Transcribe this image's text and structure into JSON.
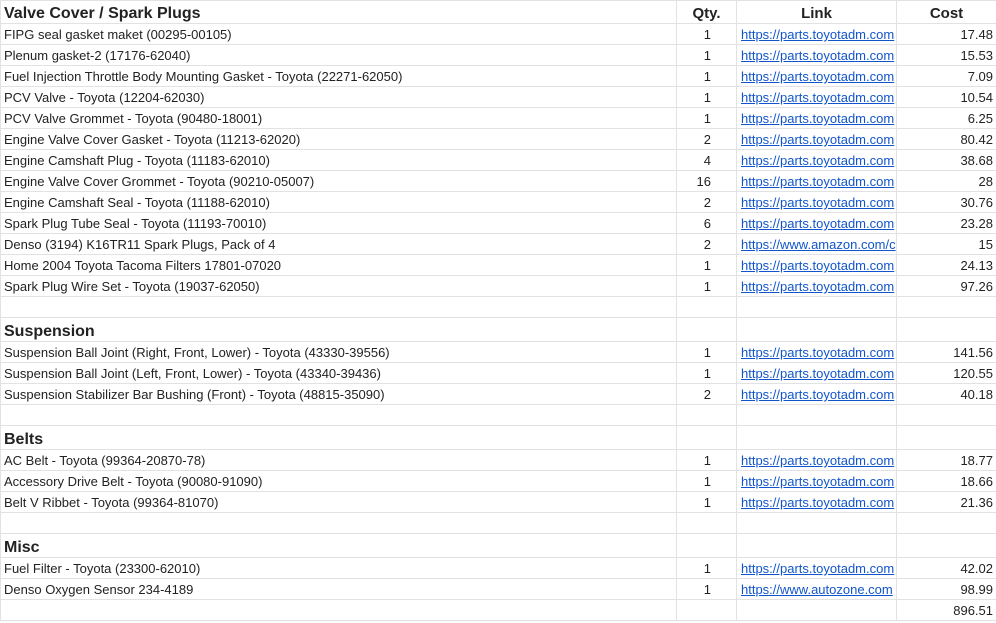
{
  "columns": {
    "item": "Valve Cover / Spark Plugs",
    "qty": "Qty.",
    "link": "Link",
    "cost": "Cost"
  },
  "rows": [
    {
      "type": "item",
      "name": "FIPG seal gasket maket (00295-00105)",
      "qty": "1",
      "link": "https://parts.toyotadm.com",
      "cost": "17.48"
    },
    {
      "type": "item",
      "name": "Plenum gasket-2 (17176-62040)",
      "qty": "1",
      "link": "https://parts.toyotadm.com",
      "cost": "15.53"
    },
    {
      "type": "item",
      "name": "Fuel Injection Throttle Body Mounting Gasket - Toyota (22271-62050)",
      "qty": "1",
      "link": "https://parts.toyotadm.com",
      "cost": "7.09"
    },
    {
      "type": "item",
      "name": "PCV Valve - Toyota (12204-62030)",
      "qty": "1",
      "link": "https://parts.toyotadm.com",
      "cost": "10.54"
    },
    {
      "type": "item",
      "name": "PCV Valve Grommet - Toyota (90480-18001)",
      "qty": "1",
      "link": "https://parts.toyotadm.com",
      "cost": "6.25"
    },
    {
      "type": "item",
      "name": "Engine Valve Cover Gasket - Toyota (11213-62020)",
      "qty": "2",
      "link": "https://parts.toyotadm.com",
      "cost": "80.42"
    },
    {
      "type": "item",
      "name": "Engine Camshaft Plug - Toyota (11183-62010)",
      "qty": "4",
      "link": "https://parts.toyotadm.com",
      "cost": "38.68"
    },
    {
      "type": "item",
      "name": "Engine Valve Cover Grommet - Toyota (90210-05007)",
      "qty": "16",
      "link": "https://parts.toyotadm.com",
      "cost": "28"
    },
    {
      "type": "item",
      "name": "Engine Camshaft Seal - Toyota (11188-62010)",
      "qty": "2",
      "link": "https://parts.toyotadm.com",
      "cost": "30.76"
    },
    {
      "type": "item",
      "name": "Spark Plug Tube Seal - Toyota (11193-70010)",
      "qty": "6",
      "link": "https://parts.toyotadm.com",
      "cost": "23.28"
    },
    {
      "type": "item",
      "name": "Denso (3194) K16TR11 Spark Plugs, Pack of 4",
      "qty": "2",
      "link": "https://www.amazon.com/c",
      "cost": "15"
    },
    {
      "type": "item",
      "name": "Home  2004 Toyota Tacoma  Filters  17801-07020",
      "qty": "1",
      "link": "https://parts.toyotadm.com",
      "cost": "24.13"
    },
    {
      "type": "item",
      "name": "Spark Plug Wire Set - Toyota (19037-62050)",
      "qty": "1",
      "link": "https://parts.toyotadm.com",
      "cost": "97.26"
    },
    {
      "type": "gap"
    },
    {
      "type": "section",
      "name": "Suspension"
    },
    {
      "type": "item",
      "name": "Suspension Ball Joint (Right, Front, Lower) - Toyota (43330-39556)",
      "qty": "1",
      "link": "https://parts.toyotadm.com",
      "cost": "141.56"
    },
    {
      "type": "item",
      "name": "Suspension Ball Joint (Left, Front, Lower) - Toyota (43340-39436)",
      "qty": "1",
      "link": "https://parts.toyotadm.com",
      "cost": "120.55"
    },
    {
      "type": "item",
      "name": "Suspension Stabilizer Bar Bushing (Front) - Toyota (48815-35090)",
      "qty": "2",
      "link": "https://parts.toyotadm.com",
      "cost": "40.18"
    },
    {
      "type": "gap"
    },
    {
      "type": "section",
      "name": "Belts"
    },
    {
      "type": "item",
      "name": "AC Belt - Toyota (99364-20870-78)",
      "qty": "1",
      "link": "https://parts.toyotadm.com",
      "cost": "18.77"
    },
    {
      "type": "item",
      "name": "Accessory Drive Belt - Toyota (90080-91090)",
      "qty": "1",
      "link": "https://parts.toyotadm.com",
      "cost": "18.66"
    },
    {
      "type": "item",
      "name": "Belt V Ribbet - Toyota (99364-81070)",
      "qty": "1",
      "link": "https://parts.toyotadm.com",
      "cost": "21.36"
    },
    {
      "type": "gap"
    },
    {
      "type": "section",
      "name": "Misc"
    },
    {
      "type": "item",
      "name": "Fuel Filter - Toyota (23300-62010)",
      "qty": "1",
      "link": "https://parts.toyotadm.com",
      "cost": "42.02"
    },
    {
      "type": "item",
      "name": "Denso Oxygen Sensor 234-4189",
      "qty": "1",
      "link": "https://www.autozone.com",
      "cost": "98.99"
    },
    {
      "type": "total",
      "cost": "896.51"
    }
  ],
  "colors": {
    "link": "#1155cc",
    "grid": "#e2e2e2",
    "text": "#222222"
  },
  "icons": []
}
